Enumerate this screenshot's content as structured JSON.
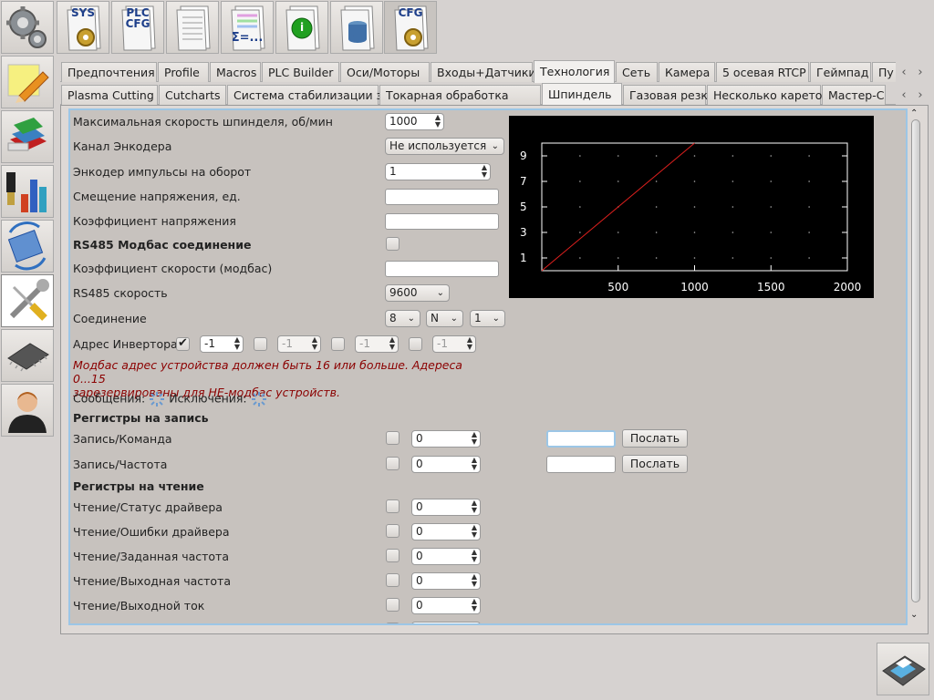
{
  "toolbar": {
    "items": [
      {
        "label": "SYS",
        "icon": "sys-gear-doc-icon"
      },
      {
        "label": "PLC CFG",
        "icon": "plc-cfg-doc-icon"
      },
      {
        "label": "",
        "icon": "table-doc-icon"
      },
      {
        "label": "Σ=...",
        "icon": "formula-doc-icon"
      },
      {
        "label": "i",
        "icon": "info-doc-icon"
      },
      {
        "label": "",
        "icon": "database-doc-icon"
      },
      {
        "label": "CFG",
        "icon": "cfg-gear-doc-icon"
      }
    ]
  },
  "sidebar": {
    "items": [
      {
        "icon": "settings-gears-icon"
      },
      {
        "icon": "edit-pencil-icon"
      },
      {
        "icon": "books-icon"
      },
      {
        "icon": "tools-bars-icon"
      },
      {
        "icon": "mycnc-rotate-icon"
      },
      {
        "icon": "wrench-screwdriver-icon"
      },
      {
        "icon": "chip-icon"
      },
      {
        "icon": "user-icon"
      }
    ]
  },
  "tabs_main": [
    "Предпочтения",
    "Profile",
    "Macros",
    "PLC Builder",
    "Оси/Моторы",
    "Входы+Датчики",
    "Технология",
    "Сеть",
    "Камера",
    "5 осевая RTCP",
    "Геймпад",
    "Пу"
  ],
  "tabs_main_active": "Технология",
  "tabs_sub": [
    "Plasma Cutting",
    "Cutcharts",
    "Система стабилизации зазора",
    "Токарная обработка",
    "Шпиндель",
    "Газовая резка",
    "Несколько кареток",
    "Мастер-С"
  ],
  "tabs_sub_active": "Шпиндель",
  "form": {
    "max_speed_label": "Максимальная скорость шпинделя, об/мин",
    "max_speed_value": "1000",
    "encoder_channel_label": "Канал Энкодера",
    "encoder_channel_value": "Не используется",
    "encoder_pulses_label": "Энкодер импульсы на оборот",
    "encoder_pulses_value": "1",
    "voltage_offset_label": "Смещение напряжения, ед.",
    "voltage_offset_value": "",
    "voltage_coeff_label": "Коэффициент напряжения",
    "voltage_coeff_value": "",
    "rs485_section": "RS485 Модбас соединение",
    "speed_coeff_label": "Коэффициент скорости (модбас)",
    "speed_coeff_value": "",
    "rs485_speed_label": "RS485 скорость",
    "rs485_speed_value": "9600",
    "connection_label": "Соединение",
    "connection_bits": "8",
    "connection_parity": "N",
    "connection_stop": "1",
    "inverter_addr_label": "Адрес Инвертора",
    "inverter_addrs": [
      "-1",
      "-1",
      "-1",
      "-1"
    ],
    "error_text": "Модбас адрес устройства должен быть  16 или больше. Адереса 0...15\nзарезервированы для НЕ-модбас устройств.",
    "messages_label": "Сообщения:",
    "exceptions_label": "Исключения:",
    "write_section": "Реггистры на запись",
    "write_rows": [
      {
        "label": "Запись/Команда",
        "value": "0",
        "send": "Послать"
      },
      {
        "label": "Запись/Частота",
        "value": "0",
        "send": "Послать"
      }
    ],
    "read_section": "Регистры на чтение",
    "read_rows": [
      {
        "label": "Чтение/Статус драйвера",
        "value": "0"
      },
      {
        "label": "Чтение/Ошибки драйвера",
        "value": "0"
      },
      {
        "label": "Чтение/Заданная частота",
        "value": "0"
      },
      {
        "label": "Чтение/Выходная частота",
        "value": "0"
      },
      {
        "label": "Чтение/Выходной ток",
        "value": "0"
      },
      {
        "label": "",
        "value": "0"
      }
    ]
  },
  "chart_data": {
    "type": "line",
    "x_ticks": [
      "500",
      "1000",
      "1500",
      "2000"
    ],
    "y_ticks": [
      "1",
      "3",
      "5",
      "7",
      "9"
    ],
    "xlim": [
      0,
      2000
    ],
    "ylim": [
      0,
      10
    ],
    "series": [
      {
        "x": [
          0,
          1000
        ],
        "y": [
          0,
          10
        ],
        "color": "#e0201e"
      }
    ],
    "background": "#000000",
    "grid": "dotted"
  },
  "colors": {
    "accent": "#9cc6e6",
    "error": "#8b0000"
  }
}
